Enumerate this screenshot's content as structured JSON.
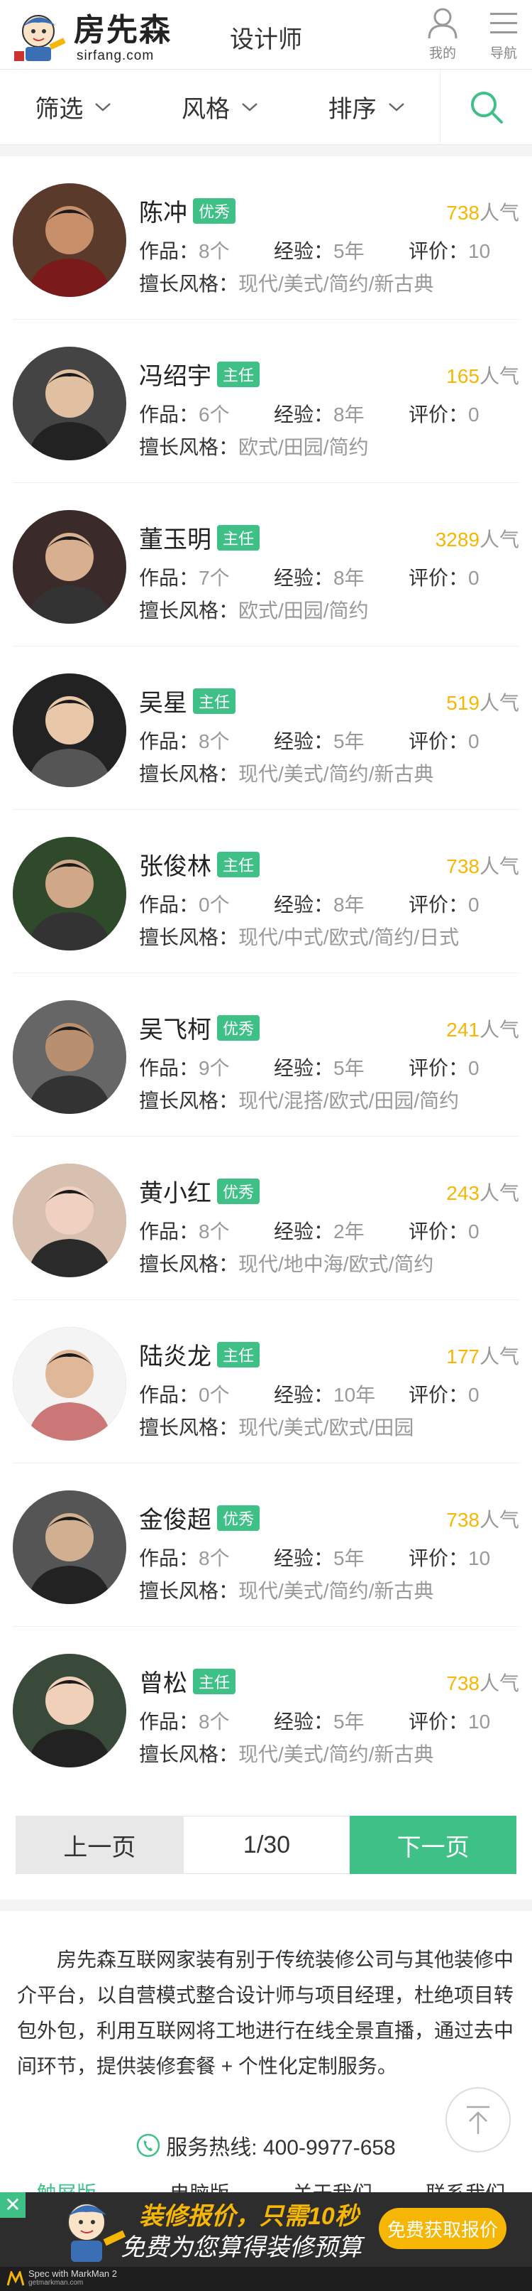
{
  "header": {
    "logo_text": "房先森",
    "logo_sub": "sirfang.com",
    "title": "设计师",
    "me_label": "我的",
    "nav_label": "导航"
  },
  "filters": {
    "filter": "筛选",
    "style": "风格",
    "sort": "排序"
  },
  "labels": {
    "works": "作品：",
    "experience": "经验：",
    "rating": "评价：",
    "styles": "擅长风格：",
    "popularity": "人气"
  },
  "designers": [
    {
      "name": "陈冲",
      "badge": "优秀",
      "popularity": "738",
      "works": "8个",
      "experience": "5年",
      "rating": "10",
      "styles": "现代/美式/简约/新古典"
    },
    {
      "name": "冯绍宇",
      "badge": "主任",
      "popularity": "165",
      "works": "6个",
      "experience": "8年",
      "rating": "0",
      "styles": "欧式/田园/简约"
    },
    {
      "name": "董玉明",
      "badge": "主任",
      "popularity": "3289",
      "works": "7个",
      "experience": "8年",
      "rating": "0",
      "styles": "欧式/田园/简约"
    },
    {
      "name": "吴星",
      "badge": "主任",
      "popularity": "519",
      "works": "8个",
      "experience": "5年",
      "rating": "0",
      "styles": "现代/美式/简约/新古典"
    },
    {
      "name": "张俊林",
      "badge": "主任",
      "popularity": "738",
      "works": "0个",
      "experience": "8年",
      "rating": "0",
      "styles": "现代/中式/欧式/简约/日式"
    },
    {
      "name": "吴飞柯",
      "badge": "优秀",
      "popularity": "241",
      "works": "9个",
      "experience": "5年",
      "rating": "0",
      "styles": "现代/混搭/欧式/田园/简约"
    },
    {
      "name": "黄小红",
      "badge": "优秀",
      "popularity": "243",
      "works": "8个",
      "experience": "2年",
      "rating": "0",
      "styles": "现代/地中海/欧式/简约"
    },
    {
      "name": "陆炎龙",
      "badge": "主任",
      "popularity": "177",
      "works": "0个",
      "experience": "10年",
      "rating": "0",
      "styles": "现代/美式/欧式/田园"
    },
    {
      "name": "金俊超",
      "badge": "优秀",
      "popularity": "738",
      "works": "8个",
      "experience": "5年",
      "rating": "10",
      "styles": "现代/美式/简约/新古典"
    },
    {
      "name": "曾松",
      "badge": "主任",
      "popularity": "738",
      "works": "8个",
      "experience": "5年",
      "rating": "10",
      "styles": "现代/美式/简约/新古典"
    }
  ],
  "pager": {
    "prev": "上一页",
    "page": "1/30",
    "next": "下一页"
  },
  "about": "房先森互联网家装有别于传统装修公司与其他装修中介平台，以自营模式整合设计师与项目经理，杜绝项目转包外包，利用互联网将工地进行在线全景直播，通过去中间环节，提供装修套餐 + 个性化定制服务。",
  "footer": {
    "hotline": "服务热线: 400-9977-658",
    "links": [
      "触屏版",
      "电脑版",
      "关于我们",
      "联系我们"
    ]
  },
  "promo": {
    "line1": "装修报价，只需10秒",
    "line2": "免费为您算得装修预算",
    "button": "免费获取报价",
    "close": "✕",
    "spec_text": "Spec with MarkMan 2",
    "spec_sub": "getmarkman.com"
  },
  "colors": {
    "accent": "#3ec087",
    "popularity": "#f6b605",
    "muted": "#999999"
  }
}
